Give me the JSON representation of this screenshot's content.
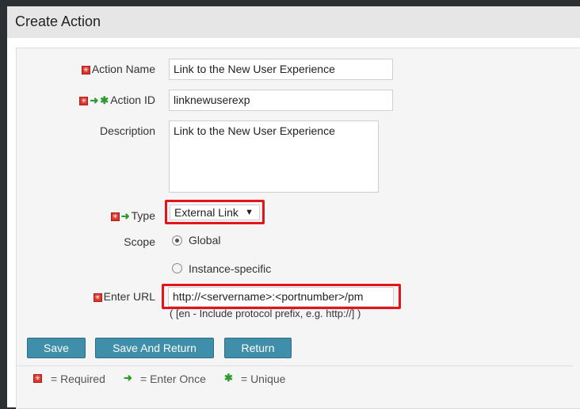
{
  "panel": {
    "title": "Create Action"
  },
  "form": {
    "action_name": {
      "label": "Action Name",
      "value": "Link to the New User Experience"
    },
    "action_id": {
      "label": "Action ID",
      "value": "linknewuserexp"
    },
    "description": {
      "label": "Description",
      "value": "Link to the New User Experience"
    },
    "type": {
      "label": "Type",
      "selected": "External Link"
    },
    "scope": {
      "label": "Scope",
      "options": [
        {
          "label": "Global",
          "selected": true
        },
        {
          "label": "Instance-specific",
          "selected": false
        }
      ]
    },
    "url": {
      "label": "Enter URL",
      "value": "http://<servername>:<portnumber>/pm",
      "hint": "( [en - Include protocol prefix, e.g. http://] )"
    }
  },
  "buttons": {
    "save": "Save",
    "save_return": "Save And Return",
    "return": "Return"
  },
  "legend": {
    "required": "= Required",
    "enter_once": "= Enter Once",
    "unique": "= Unique"
  },
  "colors": {
    "accent": "#3f8eaa",
    "highlight": "#e4141b",
    "required": "#d9342b",
    "arrow": "#2e9a2e"
  }
}
